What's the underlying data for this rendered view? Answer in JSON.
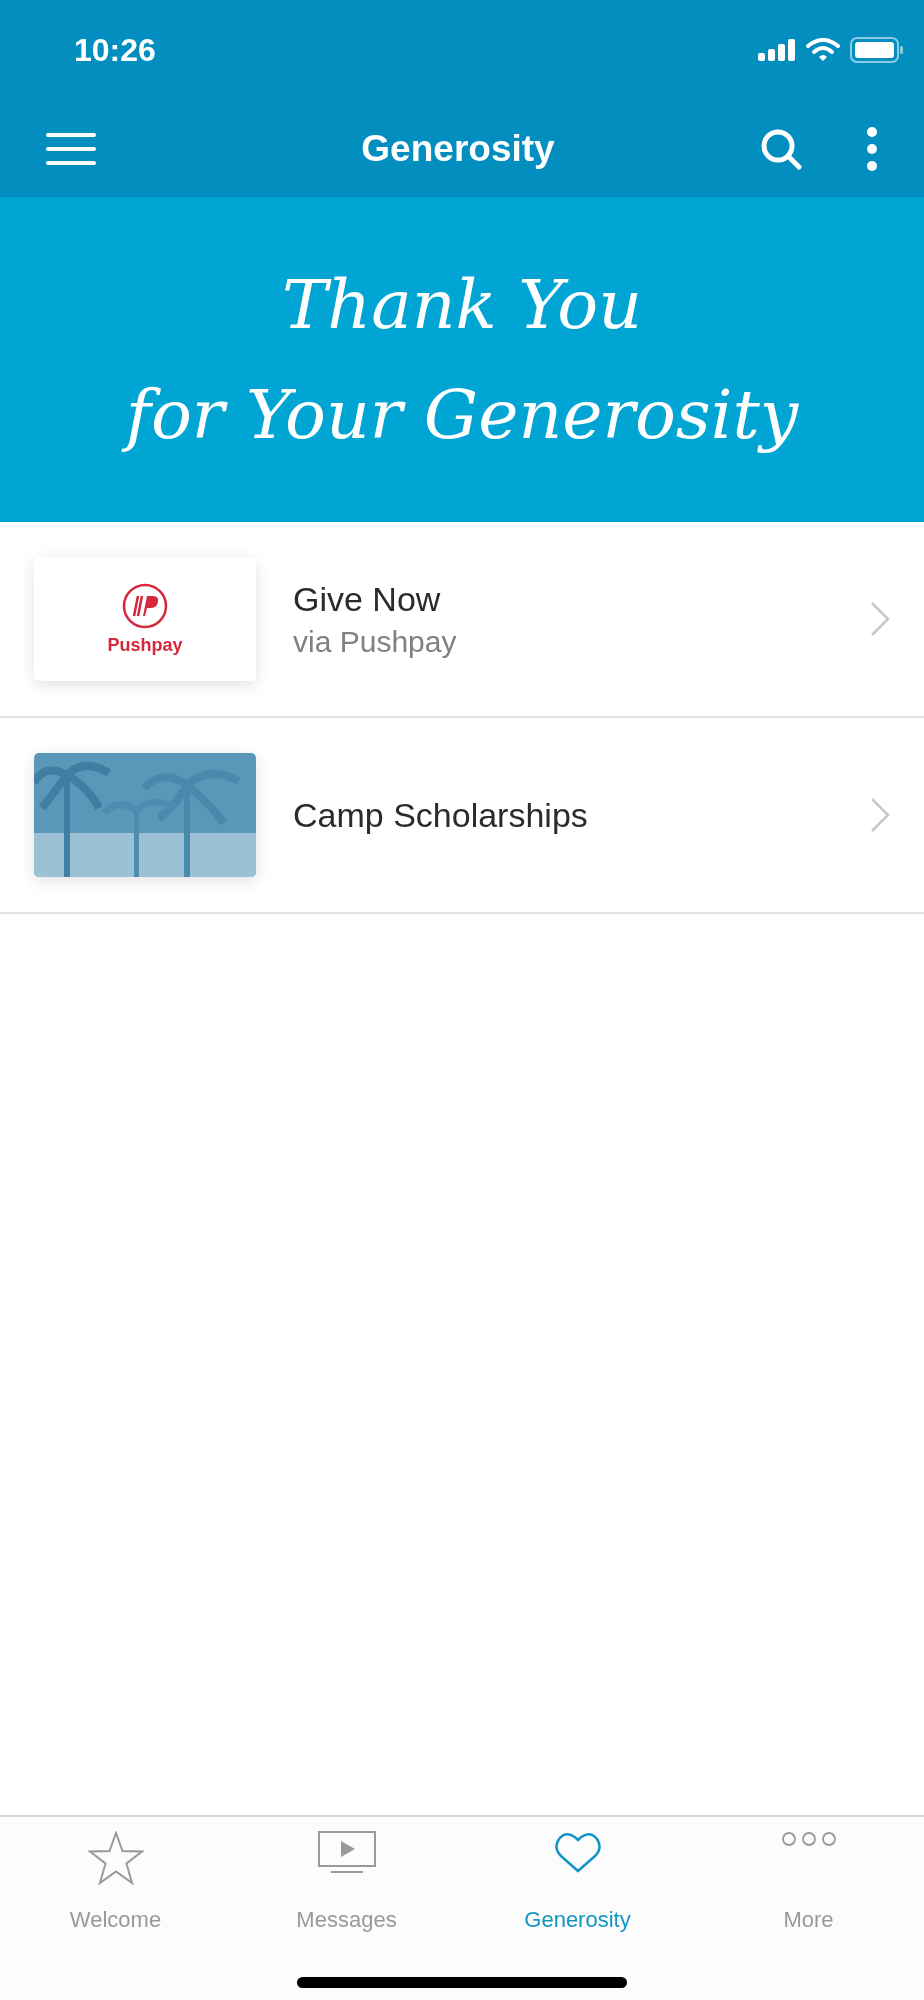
{
  "status_bar": {
    "time": "10:26"
  },
  "nav_bar": {
    "title": "Generosity"
  },
  "banner": {
    "lines": [
      "Thank You",
      "for Your Generosity"
    ]
  },
  "items": [
    {
      "title": "Give Now",
      "subtitle": "via Pushpay",
      "thumbnail": {
        "kind": "logo",
        "text": "Pushpay"
      }
    },
    {
      "title": "Camp Scholarships"
    }
  ],
  "tabs": [
    {
      "label": "Welcome",
      "kind": "star",
      "selected": false
    },
    {
      "label": "Messages",
      "kind": "tv",
      "selected": false
    },
    {
      "label": "Generosity",
      "kind": "heart",
      "selected": true
    },
    {
      "label": "More",
      "kind": "dots",
      "selected": false
    }
  ]
}
